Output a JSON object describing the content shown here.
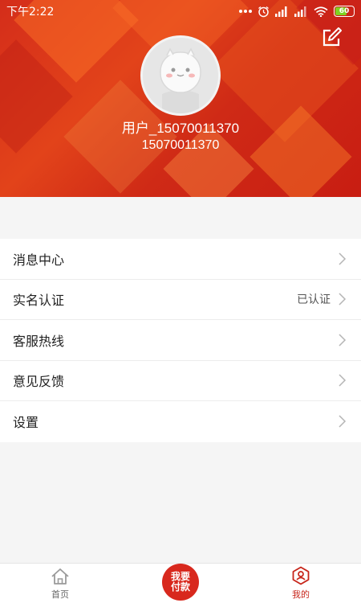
{
  "status_bar": {
    "time": "下午2:22",
    "battery": "60",
    "icons": [
      "dots-icon",
      "alarm-icon",
      "signal-icon",
      "signal-icon",
      "wifi-icon",
      "battery-icon"
    ]
  },
  "profile": {
    "username": "用户_15070011370",
    "phone": "15070011370",
    "edit_icon": "edit-icon"
  },
  "menu": {
    "items": [
      {
        "label": "消息中心",
        "value": ""
      },
      {
        "label": "实名认证",
        "value": "已认证"
      },
      {
        "label": "客服热线",
        "value": ""
      },
      {
        "label": "意见反馈",
        "value": ""
      },
      {
        "label": "设置",
        "value": ""
      }
    ]
  },
  "tabbar": {
    "home_label": "首页",
    "pay_line1": "我要",
    "pay_line2": "付款",
    "mine_label": "我的",
    "active_tab": "mine"
  },
  "colors": {
    "brand_red": "#d8281d",
    "header_red": "#d42d1a",
    "active_tab": "#c7251a"
  }
}
